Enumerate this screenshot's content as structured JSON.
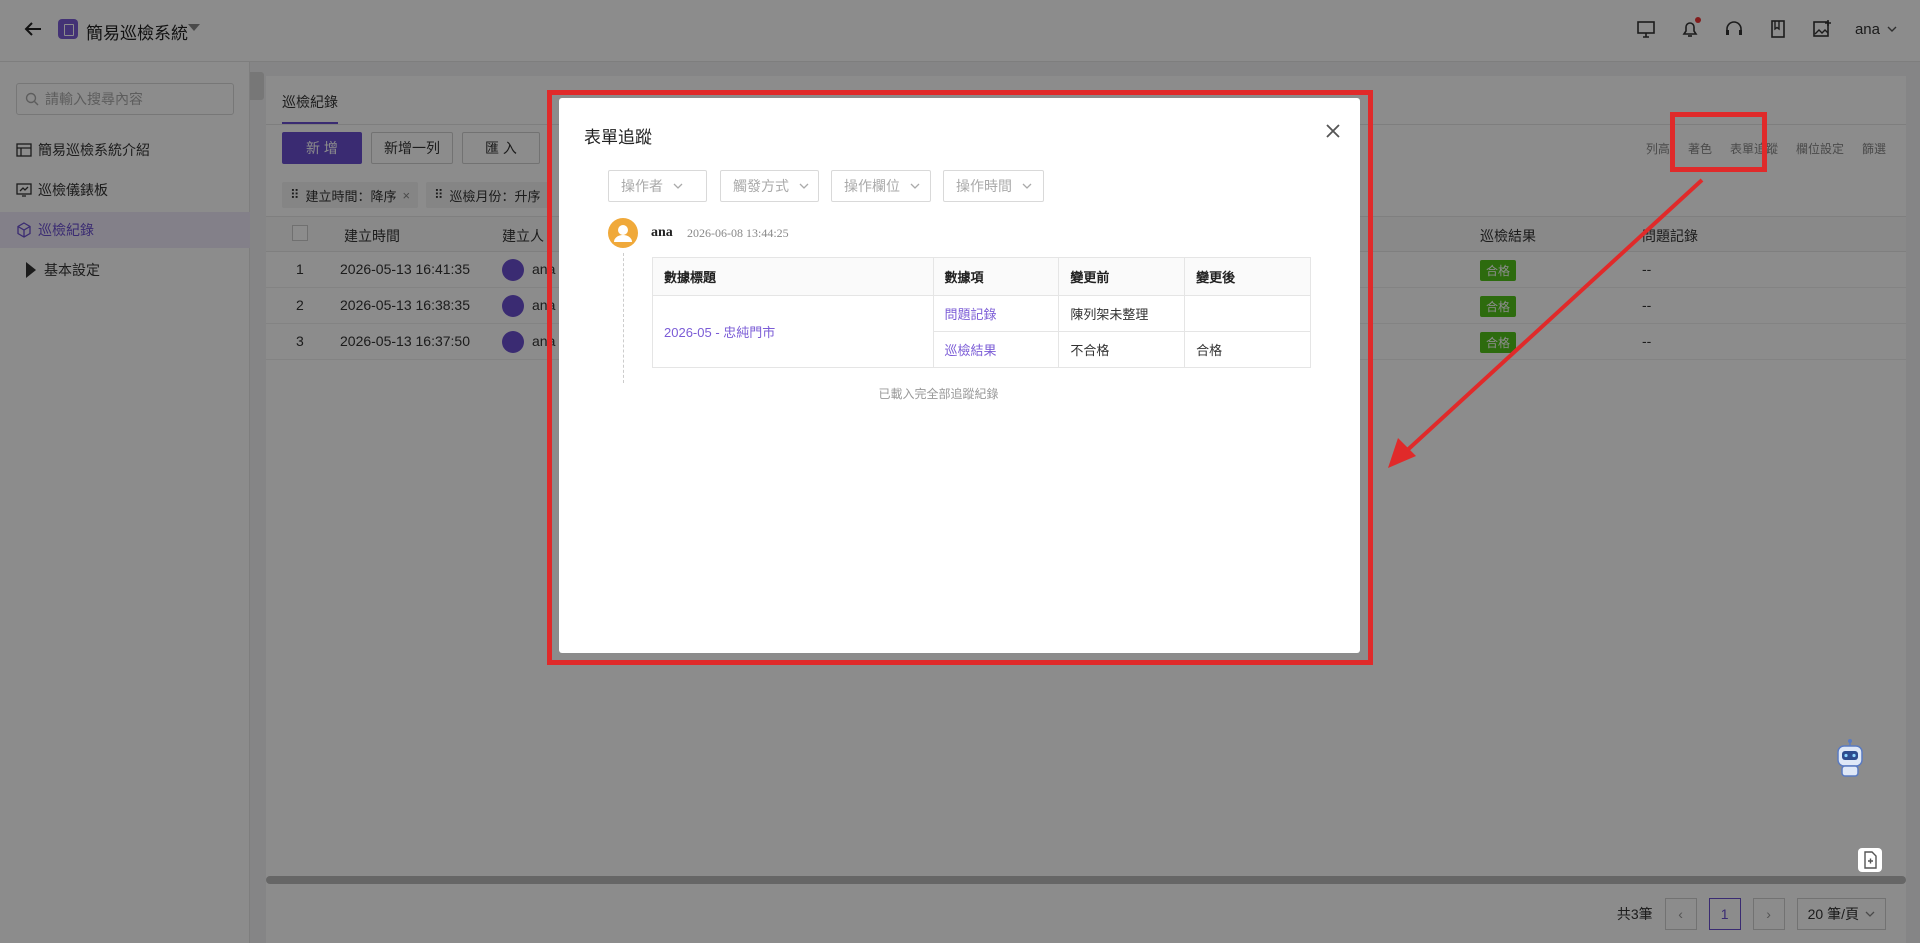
{
  "topbar": {
    "app_title": "簡易巡檢系統",
    "user_name": "ana"
  },
  "sidebar": {
    "search_placeholder": "請輸入搜尋內容",
    "items": [
      {
        "label": "簡易巡檢系統介紹",
        "icon": "table-icon"
      },
      {
        "label": "巡檢儀錶板",
        "icon": "dashboard-icon"
      },
      {
        "label": "巡檢紀錄",
        "icon": "cube-icon",
        "active": true
      },
      {
        "label": "基本設定",
        "icon": "caret-right-icon"
      }
    ]
  },
  "main": {
    "tab": "巡檢紀錄",
    "buttons": {
      "add": "新 增",
      "add_row": "新增一列",
      "import": "匯 入"
    },
    "toolbar": [
      "列高",
      "著色",
      "表單追蹤",
      "欄位設定",
      "篩選"
    ],
    "chips": [
      {
        "label": "建立時間：降序"
      },
      {
        "label": "巡檢月份：升序"
      }
    ],
    "columns": [
      "建立時間",
      "建立人",
      "巡檢結果",
      "問題記錄"
    ],
    "rows": [
      {
        "index": "1",
        "created": "2026-05-13 16:41:35",
        "creator": "ana",
        "result": "合格",
        "issue": "--"
      },
      {
        "index": "2",
        "created": "2026-05-13 16:38:35",
        "creator": "ana",
        "result": "合格",
        "issue": "--"
      },
      {
        "index": "3",
        "created": "2026-05-13 16:37:50",
        "creator": "ana",
        "result": "合格",
        "issue": "--"
      }
    ],
    "pager": {
      "total": "共3筆",
      "current": "1",
      "page_size": "20 筆/頁"
    }
  },
  "modal": {
    "title": "表單追蹤",
    "filters": [
      "操作者",
      "觸發方式",
      "操作欄位",
      "操作時間"
    ],
    "log": {
      "user": "ana",
      "time": "2026-06-08 13:44:25",
      "headers": [
        "數據標題",
        "數據項",
        "變更前",
        "變更後"
      ],
      "record_title": "2026-05 - 忠純門市",
      "changes": [
        {
          "field": "問題記錄",
          "before": "陳列架未整理",
          "after": ""
        },
        {
          "field": "巡檢結果",
          "before": "不合格",
          "after": "合格"
        }
      ]
    },
    "footer": "已載入完全部追蹤紀錄"
  },
  "colors": {
    "accent": "#6b4fd0",
    "highlight": "#e02a2a",
    "pass": "#52c41a"
  }
}
